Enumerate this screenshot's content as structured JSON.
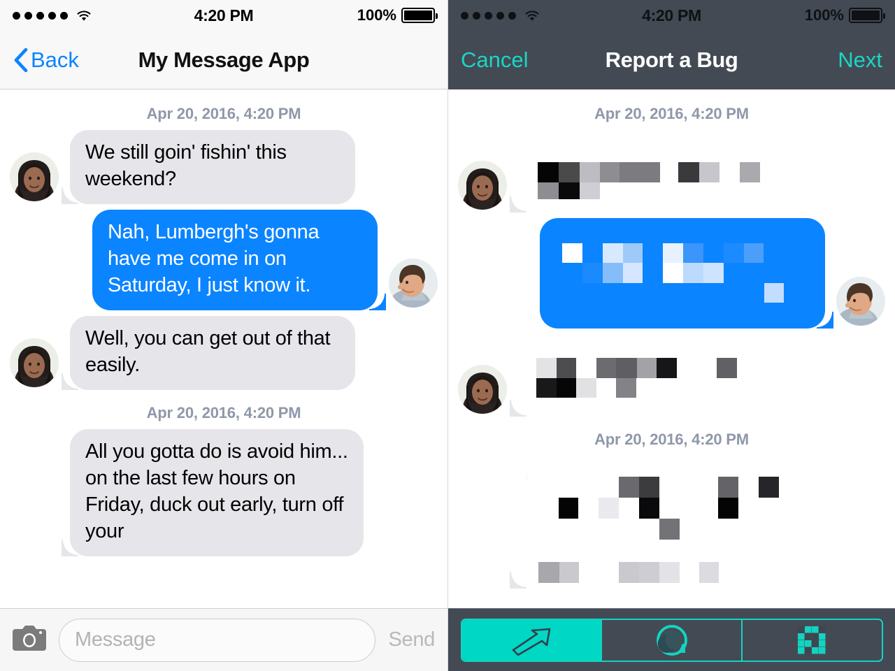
{
  "left": {
    "status": {
      "signal_dots": 5,
      "wifi_icon": "wifi-icon",
      "time": "4:20 PM",
      "battery_percent": "100%",
      "battery_icon": "battery-full-icon"
    },
    "nav": {
      "back_label": "Back",
      "back_icon": "chevron-left-icon",
      "title": "My Message App"
    },
    "thread": {
      "stamp_top": "Apr 20, 2016, 4:20 PM",
      "stamp_mid": "Apr 20, 2016, 4:20 PM",
      "messages": [
        {
          "direction": "in",
          "text": "We still goin' fishin' this weekend?",
          "avatar": "avatar-woman"
        },
        {
          "direction": "out",
          "text": "Nah, Lumbergh's gonna have me come in on Saturday, I just know it.",
          "avatar": "avatar-man"
        },
        {
          "direction": "in",
          "text": "Well, you can get out of that easily.",
          "avatar": "avatar-woman"
        },
        {
          "direction": "in",
          "text": "All you gotta do is avoid him... on the last few hours on Friday, duck out early, turn off your",
          "avatar": "avatar-woman"
        }
      ]
    },
    "input": {
      "camera_icon": "camera-icon",
      "placeholder": "Message",
      "value": "",
      "send_label": "Send"
    }
  },
  "right": {
    "status": {
      "signal_dots": 5,
      "wifi_icon": "wifi-icon",
      "time": "4:20 PM",
      "battery_percent": "100%",
      "battery_icon": "battery-full-icon"
    },
    "nav": {
      "cancel_label": "Cancel",
      "title": "Report a Bug",
      "next_label": "Next"
    },
    "thread": {
      "stamp_top": "Apr 20, 2016, 4:20 PM",
      "stamp_mid": "Apr 20, 2016, 4:20 PM",
      "redacted_note": "message text pixelated"
    },
    "toolbar": {
      "segments": [
        {
          "name": "arrow-tool",
          "icon": "arrow-up-right-icon",
          "selected": true
        },
        {
          "name": "blur-tool",
          "icon": "blur-circle-icon",
          "selected": false
        },
        {
          "name": "pixelate-tool",
          "icon": "pixelate-grid-icon",
          "selected": false
        }
      ]
    }
  },
  "colors": {
    "ios_blue": "#0b84ff",
    "bubble_gray": "#e6e5ea",
    "teal_accent": "#00d7c4",
    "dark_slate": "#434a54",
    "timestamp_gray": "#8f98a9"
  }
}
